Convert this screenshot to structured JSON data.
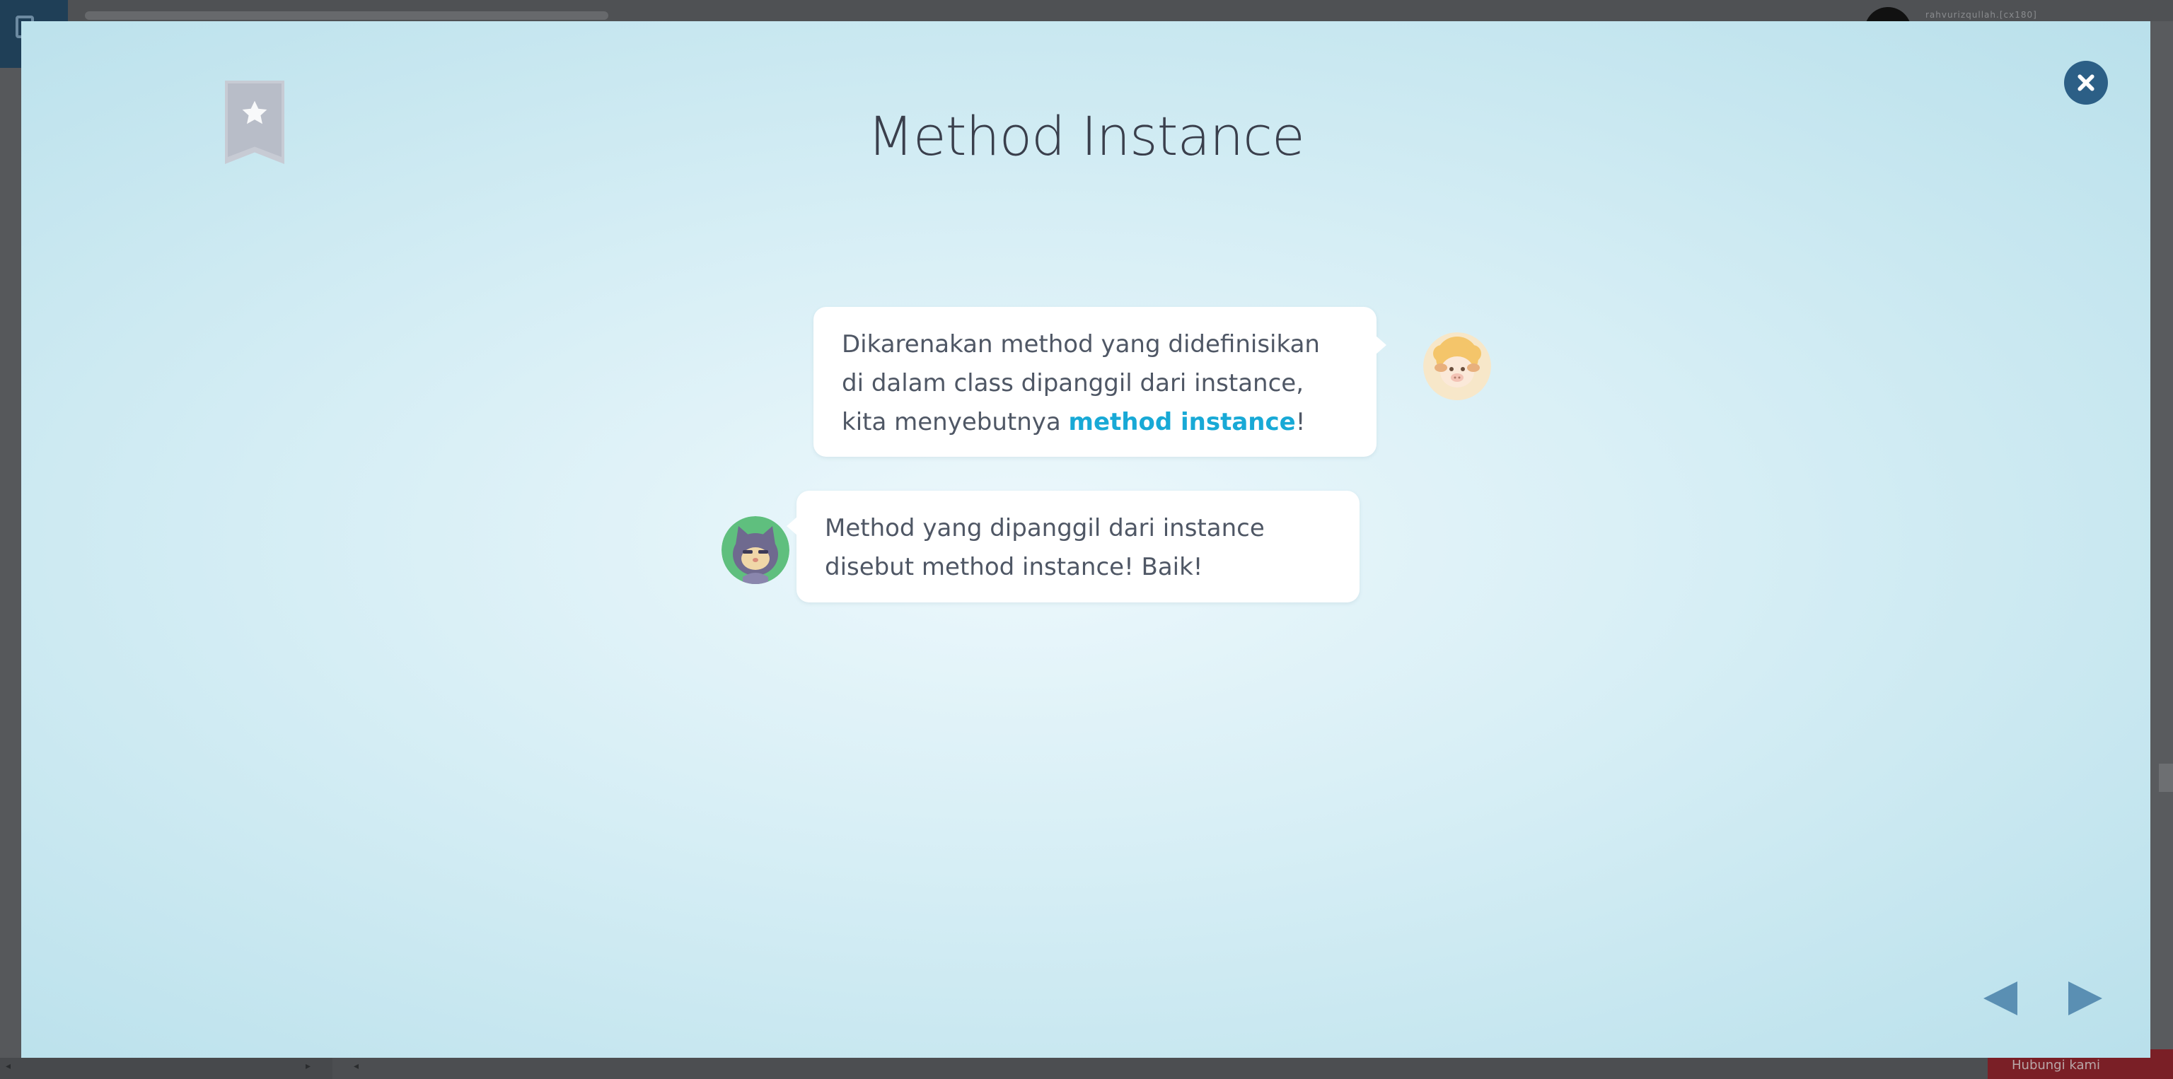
{
  "background": {
    "user_label": "rahvurizqullah.[cx180]",
    "contact_label": "Hubungi kami"
  },
  "modal": {
    "title": "Method Instance",
    "bookmark_icon": "star-bookmark-icon",
    "close_icon": "close-icon",
    "dialog": [
      {
        "speaker": "sheep",
        "text_before": "Dikarenakan method yang didefinisikan di dalam class dipanggil dari instance, kita menyebutnya ",
        "highlight": "method instance",
        "text_after": "!"
      },
      {
        "speaker": "cat",
        "text": "Method yang dipanggil dari instance disebut method instance! Baik!"
      }
    ],
    "nav": {
      "prev_icon": "triangle-left-icon",
      "next_icon": "triangle-right-icon"
    }
  },
  "colors": {
    "accent": "#18a9d6",
    "close_button": "#2c5f86",
    "nav_arrow": "#5a8fb3",
    "bookmark": "#c7cbd4"
  }
}
